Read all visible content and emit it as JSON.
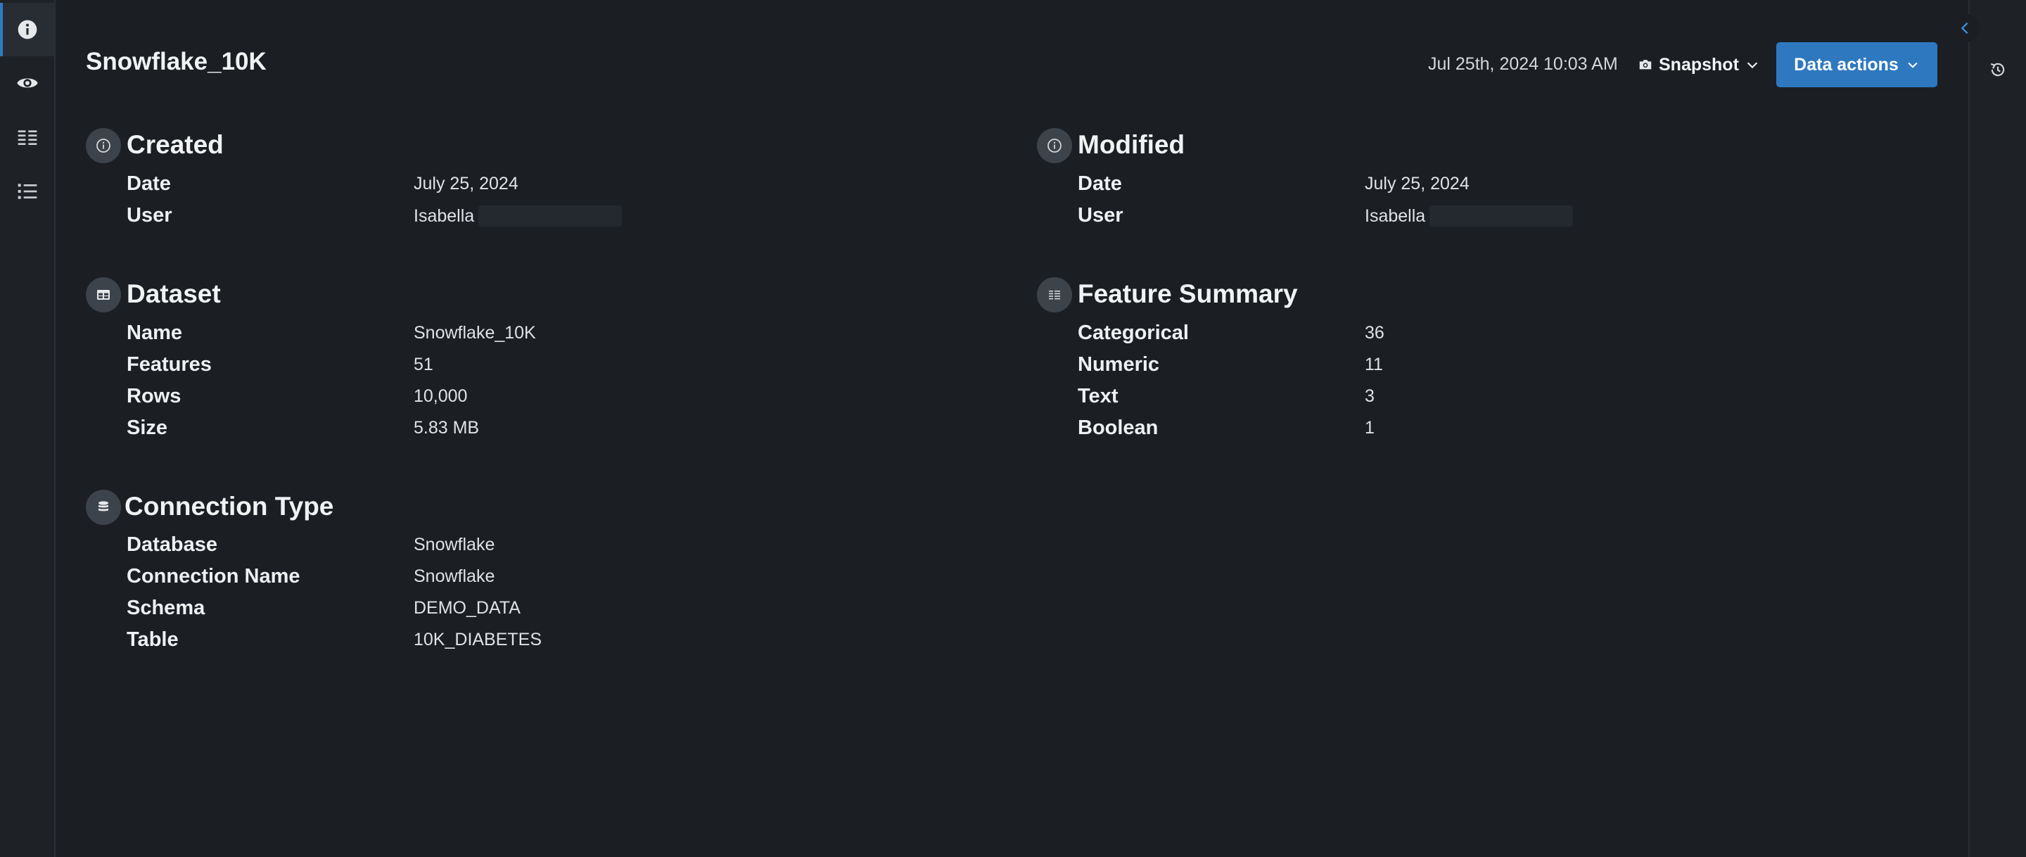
{
  "left_rail": {
    "items": [
      {
        "icon": "info-icon",
        "active": true
      },
      {
        "icon": "eye-icon",
        "active": false
      },
      {
        "icon": "columns-list-icon",
        "active": false
      },
      {
        "icon": "bullet-list-icon",
        "active": false
      }
    ]
  },
  "header": {
    "title": "Snowflake_10K",
    "timestamp": "Jul 25th, 2024 10:03 AM",
    "snapshot_label": "Snapshot",
    "data_actions_label": "Data actions"
  },
  "sections": {
    "created": {
      "title": "Created",
      "icon": "info-circle-icon",
      "rows": [
        {
          "key": "Date",
          "value": "July 25, 2024"
        },
        {
          "key": "User",
          "value": "Isabella"
        }
      ]
    },
    "modified": {
      "title": "Modified",
      "icon": "info-circle-icon",
      "rows": [
        {
          "key": "Date",
          "value": "July 25, 2024"
        },
        {
          "key": "User",
          "value": "Isabella"
        }
      ]
    },
    "dataset": {
      "title": "Dataset",
      "icon": "table-icon",
      "rows": [
        {
          "key": "Name",
          "value": "Snowflake_10K"
        },
        {
          "key": "Features",
          "value": "51"
        },
        {
          "key": "Rows",
          "value": "10,000"
        },
        {
          "key": "Size",
          "value": "5.83 MB"
        }
      ]
    },
    "feature_summary": {
      "title": "Feature Summary",
      "icon": "columns-list-icon",
      "rows": [
        {
          "key": "Categorical",
          "value": "36"
        },
        {
          "key": "Numeric",
          "value": "11"
        },
        {
          "key": "Text",
          "value": "3"
        },
        {
          "key": "Boolean",
          "value": "1"
        }
      ]
    },
    "connection": {
      "title": "Connection Type",
      "icon": "database-icon",
      "rows": [
        {
          "key": "Database",
          "value": "Snowflake"
        },
        {
          "key": "Connection Name",
          "value": "Snowflake"
        },
        {
          "key": "Schema",
          "value": "DEMO_DATA"
        },
        {
          "key": "Table",
          "value": "10K_DIABETES"
        }
      ]
    }
  },
  "colors": {
    "background": "#1b1f24",
    "accent": "#2e78c0"
  }
}
